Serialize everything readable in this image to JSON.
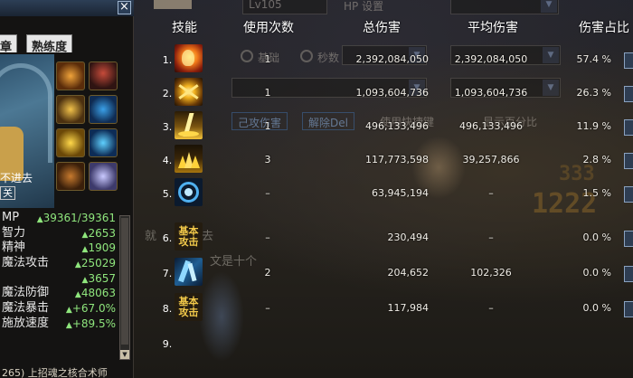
{
  "character_panel": {
    "title": "",
    "close_icon": "close-icon",
    "tabs": [
      "章",
      "熟练度"
    ],
    "notice": [
      "不进去",
      "关"
    ],
    "equipment_icons": [
      "helmet-icon",
      "shoulder-icon",
      "armor-icon",
      "gloves-icon",
      "belt-icon",
      "orb-icon",
      "weapon-icon",
      "title-icon"
    ],
    "stats": [
      {
        "name": "MP",
        "value": "39361/39361"
      },
      {
        "name": "智力",
        "value": "2653"
      },
      {
        "name": "精神",
        "value": "1909"
      },
      {
        "name": "魔法攻击",
        "value": "25029"
      },
      {
        "name": "",
        "value": "3657"
      },
      {
        "name": "魔法防御",
        "value": "48063"
      },
      {
        "name": "魔法暴击",
        "value": "+67.0%"
      },
      {
        "name": "施放速度",
        "value": "+89.5%"
      }
    ],
    "footer": "265) 上招魂之核合术师"
  },
  "settings_ghost": {
    "top_select": "Lv105",
    "top_label": "HP 设置",
    "radio_labels": [
      "基础",
      "秒数"
    ],
    "select_one": "2,392,084,050",
    "select_two": "2,392,084,050",
    "select_three": "1,093,604,736",
    "select_four": "1,093,604,736",
    "button_one": "己攻伤害",
    "button_two": "解除Del",
    "label_hotkey": "使用快捷键",
    "label_percent": "显示百分比"
  },
  "damage_table": {
    "headers": {
      "skill": "技能",
      "count": "使用次数",
      "total": "总伤害",
      "avg": "平均伤害",
      "pct": "伤害占比"
    },
    "rows": [
      {
        "index": "1.",
        "icon": "fire-burst-icon",
        "count": "1",
        "total": "2,392,084,050",
        "avg": "2,392,084,050",
        "pct": "57.4 %"
      },
      {
        "index": "2.",
        "icon": "gold-explosion-icon",
        "count": "1",
        "total": "1,093,604,736",
        "avg": "1,093,604,736",
        "pct": "26.3 %"
      },
      {
        "index": "3.",
        "icon": "lightning-strike-icon",
        "count": "1",
        "total": "496,133,496",
        "avg": "496,133,496",
        "pct": "11.9 %"
      },
      {
        "index": "4.",
        "icon": "golden-crown-icon",
        "count": "3",
        "total": "117,773,598",
        "avg": "39,257,866",
        "pct": "2.8 %"
      },
      {
        "index": "5.",
        "icon": "blue-vortex-icon",
        "count": "–",
        "total": "63,945,194",
        "avg": "–",
        "pct": "1.5 %"
      },
      {
        "index": "6.",
        "icon": "basic-attack-icon",
        "icon_text": [
          "基本",
          "攻击"
        ],
        "count": "–",
        "total": "230,494",
        "avg": "–",
        "pct": "0.0 %"
      },
      {
        "index": "7.",
        "icon": "ice-shard-icon",
        "count": "2",
        "total": "204,652",
        "avg": "102,326",
        "pct": "0.0 %"
      },
      {
        "index": "8.",
        "icon": "basic-attack-icon",
        "icon_text": [
          "基本",
          "攻击"
        ],
        "count": "–",
        "total": "117,984",
        "avg": "–",
        "pct": "0.0 %"
      },
      {
        "index": "9.",
        "icon": "",
        "count": "",
        "total": "",
        "avg": "",
        "pct": ""
      }
    ]
  },
  "scene_ghost": {
    "big_number": "1222",
    "ghost_chat": [
      "就",
      "进去",
      "文是十个"
    ]
  }
}
